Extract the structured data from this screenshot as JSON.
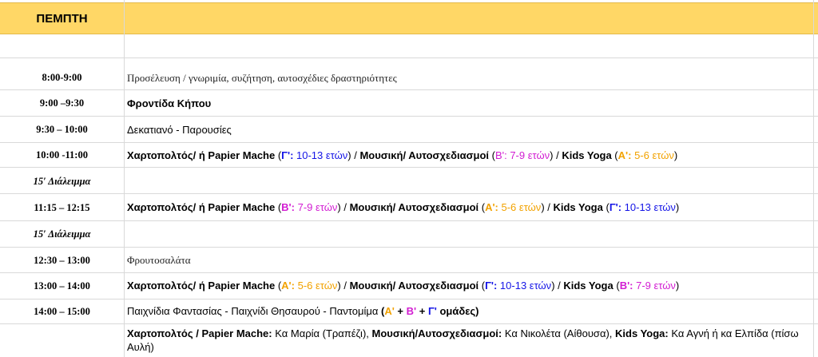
{
  "header": {
    "day": "ΠΕΜΠΤΗ"
  },
  "rows": [
    {
      "time": "8:00-9:00",
      "activity": "Προσέλευση / γνωριμία, συζήτηση, αυτοσχέδιες δραστηριότητες"
    },
    {
      "time": "9:00 –9:30",
      "activity": "Φροντίδα Κήπου"
    },
    {
      "time": "9:30 – 10:00",
      "activity": "Δεκατιανό - Παρουσίες"
    },
    {
      "time": "10:00 -11:00",
      "parts": {
        "a1": "Χαρτοπολτός/ ή Papier Mache",
        "a2": " (",
        "a3": "Γ':",
        "a4": " 10-13 ετών",
        "a5": ") / ",
        "a6": "Μουσική/ Αυτοσχεδιασμοί",
        "a7": "  (",
        "a8": "Β': 7-9 ετών",
        "a9": ") / ",
        "a10": "Kids Yoga",
        "a11": "  (",
        "a12": "Α':",
        "a13": " 5-6 ετών",
        "a14": ")"
      }
    },
    {
      "time": "15′ Διάλειμμα"
    },
    {
      "time": "11:15 – 12:15",
      "parts": {
        "a1": "Χαρτοπολτός/ ή Papier Mache",
        "a2": " (",
        "a3": "Β':",
        "a4": " 7-9  ετών",
        "a5": ") /  ",
        "a6": "Μουσική/ Αυτοσχεδιασμοί",
        "a7": " (",
        "a8": "Α':",
        "a9": " 5-6 ετών",
        "a10": ") / ",
        "a11": "Kids Yoga",
        "a12": "   (",
        "a13": "Γ':",
        "a14": " 10-13 ετών",
        "a15": ")"
      }
    },
    {
      "time": "15′ Διάλειμμα"
    },
    {
      "time": "12:30 – 13:00",
      "activity": "Φρουτοσαλάτα"
    },
    {
      "time": "13:00 – 14:00",
      "parts": {
        "a1": "Χαρτοπολτός/ ή Papier Mache",
        "a2": " (",
        "a3": "Α':",
        "a4": " 5-6  ετών",
        "a5": ") /  ",
        "a6": "Μουσική/ Αυτοσχεδιασμοί",
        "a7": " (",
        "a8": "Γ':",
        "a9": " 10-13 ετών",
        "a10": ") / ",
        "a11": "Kids Yoga",
        "a12": " (",
        "a13": "Β':",
        "a14": " 7-9 ετών",
        "a15": ")"
      }
    },
    {
      "time": "14:00 – 15:00",
      "parts": {
        "a1": "Παιχνίδια Φαντασίας - Παιχνίδι Θησαυρού - Παντομίμα ",
        "a2": "(",
        "a3": "Α'",
        "a4": " + ",
        "a5": "Β'",
        "a6": " + ",
        "a7": "Γ'",
        "a8": " ομάδες)"
      }
    },
    {
      "time": "",
      "parts": {
        "a1": "Χαρτοπολτός / Papier Mache:",
        "a2": " Κα Μαρία (Τραπέζι), ",
        "a3": "Μουσική/Αυτοσχεδιασμοί:",
        "a4": " Κα Νικολέτα (Αίθουσα), ",
        "a5": "Kids Yoga:",
        "a6": " Κα Αγνή ή κα Ελπίδα (πίσω Αυλή)"
      }
    }
  ],
  "colors": {
    "header_bg": "#ffd766",
    "grade_c": "#1414e6",
    "grade_b": "#d21dd2",
    "grade_a": "#f2a200"
  }
}
